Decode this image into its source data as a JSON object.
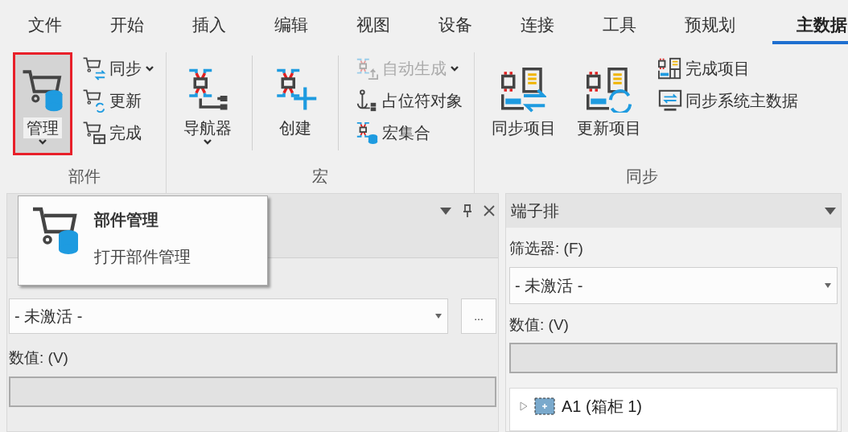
{
  "tabs": [
    {
      "label": "文件",
      "selected": false
    },
    {
      "label": "开始",
      "selected": false
    },
    {
      "label": "插入",
      "selected": false
    },
    {
      "label": "编辑",
      "selected": false
    },
    {
      "label": "视图",
      "selected": false
    },
    {
      "label": "设备",
      "selected": false
    },
    {
      "label": "连接",
      "selected": false
    },
    {
      "label": "工具",
      "selected": false
    },
    {
      "label": "预规划",
      "selected": false
    },
    {
      "label": "主数据",
      "selected": true
    }
  ],
  "ribbon": {
    "groups": [
      {
        "label": "部件",
        "divided": false,
        "items": [
          {
            "label": "管理",
            "kind": "large",
            "dropdown": true,
            "disabled": false,
            "selected": true
          },
          {
            "label": "同步",
            "kind": "small",
            "dropdown": true,
            "disabled": false,
            "selected": false
          },
          {
            "label": "更新",
            "kind": "small",
            "dropdown": false,
            "disabled": false,
            "selected": false
          },
          {
            "label": "完成",
            "kind": "small",
            "dropdown": false,
            "disabled": false,
            "selected": false
          }
        ]
      },
      {
        "label": "宏",
        "divided": true,
        "items": [
          {
            "label": "导航器",
            "kind": "large",
            "dropdown": true,
            "disabled": false,
            "selected": false
          },
          {
            "label": "创建",
            "kind": "large",
            "dropdown": false,
            "disabled": false,
            "selected": false
          },
          {
            "label": "自动生成",
            "kind": "small",
            "dropdown": true,
            "disabled": true,
            "selected": false
          },
          {
            "label": "占位符对象",
            "kind": "small",
            "dropdown": false,
            "disabled": false,
            "selected": false
          },
          {
            "label": "宏集合",
            "kind": "small",
            "dropdown": false,
            "disabled": false,
            "selected": false
          }
        ]
      },
      {
        "label": "同步",
        "divided": false,
        "items": [
          {
            "label": "同步项目",
            "kind": "large",
            "dropdown": false,
            "disabled": false,
            "selected": false
          },
          {
            "label": "更新项目",
            "kind": "large",
            "dropdown": false,
            "disabled": false,
            "selected": false
          },
          {
            "label": "完成项目",
            "kind": "small",
            "dropdown": false,
            "disabled": false,
            "selected": false
          },
          {
            "label": "同步系统主数据",
            "kind": "small",
            "dropdown": false,
            "disabled": false,
            "selected": false
          }
        ]
      }
    ]
  },
  "left_panel": {
    "filter_value": "- 未激活 -",
    "more_button": "...",
    "value_label": "数值: (V)"
  },
  "right_panel": {
    "title": "端子排",
    "filter_label": "筛选器: (F)",
    "filter_value": "- 未激活 -",
    "value_label": "数值: (V)",
    "tree": [
      {
        "label": "A1 (箱柜 1)",
        "expanded": false
      }
    ]
  },
  "tooltip": {
    "title": "部件管理",
    "description": "打开部件管理"
  }
}
